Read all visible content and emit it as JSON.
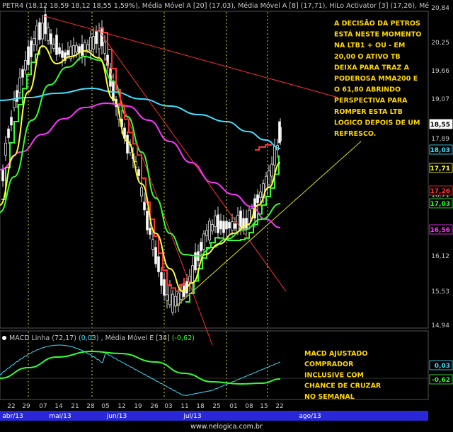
{
  "top_header": {
    "text": "PETR4 (18,12  18,59  18,12  18,55  1,59%), Média Móvel A [20] (17,03), Média Móvel A [8] (17,71), HiLo Activator [3] (17,26), Mé"
  },
  "price_axis": {
    "ticks": [
      "20,84",
      "20,25",
      "19,66",
      "19,07",
      "18,55",
      "17,89",
      "17,30",
      "16,71",
      "16,12",
      "15,53",
      "14,94"
    ],
    "tags": [
      {
        "label": "18,55",
        "bg": "#ffffff",
        "fg": "#000000"
      },
      {
        "label": "18,03",
        "bg": "#000000",
        "fg": "#40e0ff"
      },
      {
        "label": "17,71",
        "bg": "#000000",
        "fg": "#ffff33"
      },
      {
        "label": "17,26",
        "bg": "#000000",
        "fg": "#ff3333"
      },
      {
        "label": "17,03",
        "bg": "#000000",
        "fg": "#33ff33"
      },
      {
        "label": "16,56",
        "bg": "#000000",
        "fg": "#ff33ff"
      }
    ]
  },
  "annotation_main": [
    "A DECISÃO DA PETROS",
    "ESTÁ NESTE MOMENTO",
    "NA LTB1 + OU - EM",
    "20,00 O ATIVO TB",
    "DEIXA PARA TRAZ A",
    "PODEROSA MMA200 E",
    "O 61,80 ABRINDO",
    "PERSPECTIVA PARA",
    "ROMPER ESTA LTB",
    "LOGICO  DEPOIS DE UM",
    "REFRESCO."
  ],
  "macd_header": {
    "prefix": "MACD Linha (72,17)",
    "value1": "(0,03)",
    "middle": ", Média Móvel E [34]",
    "value2": "(-0,62)"
  },
  "macd_axis_tags": [
    {
      "label": "0,03",
      "fg": "#40e0ff"
    },
    {
      "label": "-0,62",
      "fg": "#33ff33"
    }
  ],
  "annotation_macd": [
    "MACD AJUSTADO",
    "COMPRADOR",
    "INCLUSIVE COM",
    "CHANCE DE CRUZAR",
    "NO SEMANAL"
  ],
  "x_axis": {
    "days": [
      "22",
      "29",
      "07",
      "14",
      "21",
      "28",
      "05",
      "12",
      "19",
      "26",
      "03",
      "11",
      "18",
      "25",
      "01",
      "08",
      "15",
      "22"
    ],
    "months": [
      "abr/13",
      "mai/13",
      "jun/13",
      "jul/13",
      "ago/13"
    ]
  },
  "footer": {
    "url": "www.nelogica.com.br"
  },
  "colors": {
    "background": "#000000",
    "ma200": "#40e0ff",
    "ma8": "#ffff33",
    "hilo": "#ff3333",
    "ma20": "#33ff33",
    "ma_magenta": "#ff33ff",
    "annotation": "#ffd700",
    "timeline": "#2828d8"
  }
}
